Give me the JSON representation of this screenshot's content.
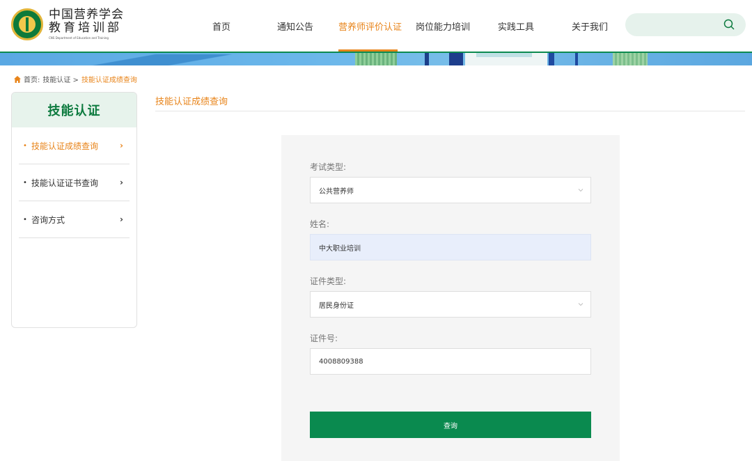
{
  "header": {
    "logo_title": "中国营养学会",
    "logo_title2": "教育培训部",
    "logo_sub": "CNS Department of Education and Training",
    "nav": [
      {
        "label": "首页",
        "active": false
      },
      {
        "label": "通知公告",
        "active": false
      },
      {
        "label": "营养师评价认证",
        "active": true
      },
      {
        "label": "岗位能力培训",
        "active": false
      },
      {
        "label": "实践工具",
        "active": false
      },
      {
        "label": "关于我们",
        "active": false
      }
    ],
    "search_icon": "search-icon"
  },
  "breadcrumb": {
    "home": "首页:",
    "level1": "技能认证 >",
    "current": "技能认证成绩查询"
  },
  "sidebar": {
    "title": "技能认证",
    "items": [
      {
        "label": "技能认证成绩查询",
        "active": true
      },
      {
        "label": "技能认证证书查询",
        "active": false
      },
      {
        "label": "咨询方式",
        "active": false
      }
    ]
  },
  "main": {
    "title": "技能认证成绩查询",
    "form": {
      "exam_type_label": "考试类型:",
      "exam_type_value": "公共营养师",
      "name_label": "姓名:",
      "name_value": "中大职业培训",
      "id_type_label": "证件类型:",
      "id_type_value": "居民身份证",
      "id_number_label": "证件号:",
      "id_number_value": "4008809388",
      "submit_label": "查询"
    }
  },
  "colors": {
    "accent": "#e8841a",
    "brand_green": "#0a8a4f",
    "sidebar_head_bg": "#e7f3ec"
  }
}
